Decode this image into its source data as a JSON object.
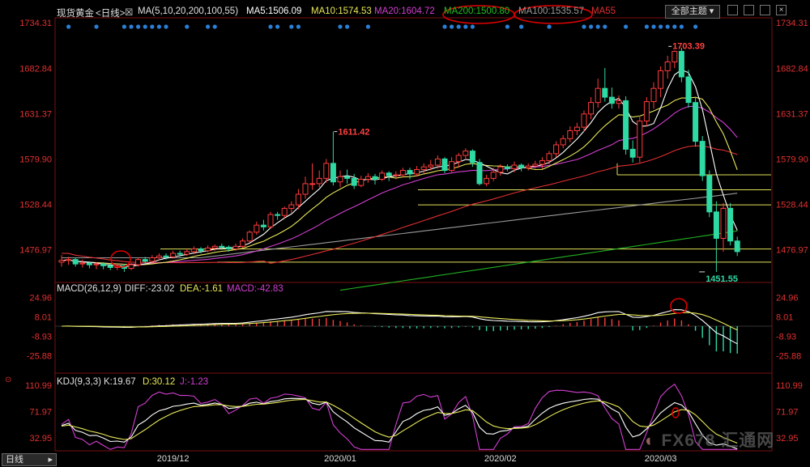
{
  "header": {
    "symbol": "现货黄金",
    "period": "<日线>",
    "ma_params": "MA(5,10,20,200,100,55)",
    "ma5": "MA5:1506.09",
    "ma10": "MA10:1574.53",
    "ma20": "MA20:1604.72",
    "ma200": "MA200:1500.80",
    "ma100": "MA100:1535.57",
    "ma55": "MA55",
    "theme_button": "全部主题",
    "period_button": "日线"
  },
  "macd": {
    "params": "MACD(26,12,9)",
    "diff": "DIFF:-23.02",
    "dea": "DEA:-1.61",
    "macd": "MACD:-42.83"
  },
  "kdj": {
    "params": "KDJ(9,3,3)",
    "k": "K:19.67",
    "d": "D:30.12",
    "j": "J:-1.23"
  },
  "watermark": "FX678 汇通网",
  "colors": {
    "up": "#ff3b3b",
    "down": "#2ed9a4",
    "ma5": "#ffffff",
    "ma10": "#e8e85a",
    "ma20": "#d23fd2",
    "ma55": "#e03030",
    "ma100": "#9a9a9a",
    "ma200": "#22b022",
    "line": "#e0e05a",
    "text_red": "#ff4040"
  },
  "chart_data": [
    {
      "type": "candlestick",
      "ylim": [
        1440,
        1740
      ],
      "y_ticks": [
        "1734.31",
        "1682.84",
        "1631.37",
        "1579.90",
        "1528.44",
        "1476.97"
      ],
      "x_labels": [
        "2019/12",
        "2020/01",
        "2020/02",
        "2020/03"
      ],
      "annotations": [
        "1611.42",
        "1703.39",
        "1451.55"
      ],
      "candles": [
        [
          1463,
          1465,
          1458,
          1471
        ],
        [
          1465,
          1466,
          1460,
          1469
        ],
        [
          1466,
          1461,
          1458,
          1468
        ],
        [
          1461,
          1462,
          1457,
          1466
        ],
        [
          1462,
          1460,
          1456,
          1464
        ],
        [
          1460,
          1461,
          1455,
          1463
        ],
        [
          1461,
          1459,
          1455,
          1463
        ],
        [
          1459,
          1457,
          1454,
          1461
        ],
        [
          1457,
          1459,
          1454,
          1461
        ],
        [
          1459,
          1456,
          1452,
          1461
        ],
        [
          1456,
          1460,
          1454,
          1462
        ],
        [
          1460,
          1466,
          1458,
          1468
        ],
        [
          1466,
          1464,
          1461,
          1469
        ],
        [
          1464,
          1468,
          1462,
          1471
        ],
        [
          1468,
          1470,
          1465,
          1473
        ],
        [
          1470,
          1469,
          1466,
          1473
        ],
        [
          1469,
          1473,
          1467,
          1476
        ],
        [
          1473,
          1472,
          1469,
          1476
        ],
        [
          1472,
          1475,
          1470,
          1478
        ],
        [
          1475,
          1478,
          1472,
          1481
        ],
        [
          1478,
          1476,
          1473,
          1480
        ],
        [
          1476,
          1479,
          1474,
          1482
        ],
        [
          1479,
          1481,
          1476,
          1483
        ],
        [
          1481,
          1480,
          1477,
          1484
        ],
        [
          1480,
          1478,
          1475,
          1482
        ],
        [
          1478,
          1481,
          1476,
          1484
        ],
        [
          1481,
          1487,
          1479,
          1490
        ],
        [
          1487,
          1497,
          1485,
          1499
        ],
        [
          1497,
          1505,
          1494,
          1509
        ],
        [
          1505,
          1503,
          1499,
          1511
        ],
        [
          1503,
          1517,
          1501,
          1520
        ],
        [
          1517,
          1516,
          1511,
          1520
        ],
        [
          1516,
          1524,
          1513,
          1526
        ],
        [
          1524,
          1528,
          1519,
          1532
        ],
        [
          1528,
          1540,
          1523,
          1546
        ],
        [
          1540,
          1552,
          1535,
          1560
        ],
        [
          1552,
          1552,
          1545,
          1575
        ],
        [
          1552,
          1558,
          1548,
          1567
        ],
        [
          1558,
          1575,
          1553,
          1580
        ],
        [
          1575,
          1554,
          1550,
          1611
        ],
        [
          1554,
          1560,
          1548,
          1567
        ],
        [
          1560,
          1558,
          1552,
          1568
        ],
        [
          1558,
          1550,
          1546,
          1563
        ],
        [
          1550,
          1557,
          1548,
          1561
        ],
        [
          1557,
          1560,
          1553,
          1564
        ],
        [
          1560,
          1557,
          1551,
          1563
        ],
        [
          1557,
          1564,
          1555,
          1567
        ],
        [
          1564,
          1561,
          1555,
          1566
        ],
        [
          1561,
          1562,
          1557,
          1566
        ],
        [
          1562,
          1567,
          1559,
          1570
        ],
        [
          1567,
          1563,
          1557,
          1570
        ],
        [
          1563,
          1568,
          1560,
          1572
        ],
        [
          1568,
          1571,
          1563,
          1575
        ],
        [
          1571,
          1573,
          1567,
          1579
        ],
        [
          1573,
          1580,
          1569,
          1584
        ],
        [
          1580,
          1567,
          1564,
          1582
        ],
        [
          1567,
          1577,
          1565,
          1582
        ],
        [
          1577,
          1584,
          1570,
          1587
        ],
        [
          1584,
          1589,
          1579,
          1592
        ],
        [
          1589,
          1576,
          1571,
          1591
        ],
        [
          1576,
          1552,
          1550,
          1580
        ],
        [
          1552,
          1558,
          1549,
          1562
        ],
        [
          1558,
          1565,
          1555,
          1570
        ],
        [
          1565,
          1571,
          1561,
          1574
        ],
        [
          1571,
          1569,
          1566,
          1574
        ],
        [
          1569,
          1573,
          1565,
          1577
        ],
        [
          1573,
          1570,
          1566,
          1575
        ],
        [
          1570,
          1572,
          1567,
          1575
        ],
        [
          1572,
          1574,
          1569,
          1578
        ],
        [
          1574,
          1578,
          1569,
          1582
        ],
        [
          1578,
          1586,
          1574,
          1589
        ],
        [
          1586,
          1596,
          1582,
          1600
        ],
        [
          1596,
          1603,
          1592,
          1607
        ],
        [
          1603,
          1612,
          1599,
          1617
        ],
        [
          1612,
          1616,
          1607,
          1621
        ],
        [
          1616,
          1631,
          1611,
          1635
        ],
        [
          1631,
          1644,
          1625,
          1650
        ],
        [
          1644,
          1660,
          1638,
          1671
        ],
        [
          1660,
          1650,
          1645,
          1683
        ],
        [
          1650,
          1643,
          1637,
          1661
        ],
        [
          1643,
          1646,
          1637,
          1652
        ],
        [
          1646,
          1591,
          1585,
          1651
        ],
        [
          1591,
          1582,
          1576,
          1601
        ],
        [
          1582,
          1623,
          1576,
          1629
        ],
        [
          1623,
          1645,
          1617,
          1650
        ],
        [
          1645,
          1660,
          1637,
          1667
        ],
        [
          1660,
          1680,
          1650,
          1685
        ],
        [
          1680,
          1690,
          1671,
          1697
        ],
        [
          1690,
          1702,
          1683,
          1703
        ],
        [
          1702,
          1673,
          1667,
          1706
        ],
        [
          1673,
          1644,
          1638,
          1681
        ],
        [
          1644,
          1600,
          1594,
          1650
        ],
        [
          1600,
          1561,
          1555,
          1606
        ],
        [
          1561,
          1520,
          1514,
          1567
        ],
        [
          1520,
          1490,
          1452,
          1532
        ],
        [
          1490,
          1524,
          1475,
          1530
        ],
        [
          1524,
          1487,
          1482,
          1530
        ],
        [
          1487,
          1475,
          1470,
          1492
        ]
      ]
    },
    {
      "type": "bar",
      "title": "MACD(26,12,9)",
      "y_ticks": [
        "24.96",
        "8.01",
        "-8.93",
        "-25.88"
      ],
      "ylim": [
        -41,
        36
      ]
    },
    {
      "type": "line",
      "title": "KDJ(9,3,3)",
      "y_ticks": [
        "110.99",
        "71.97",
        "32.95"
      ],
      "ylim": [
        14,
        118
      ]
    }
  ]
}
